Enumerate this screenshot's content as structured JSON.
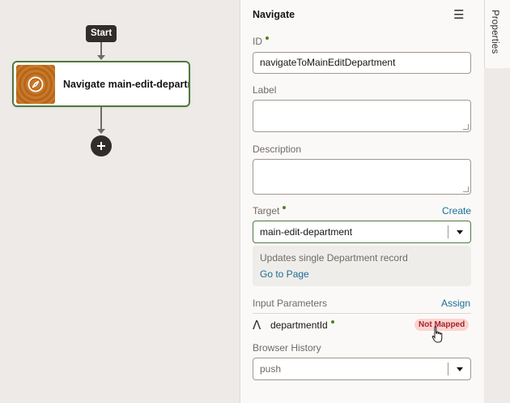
{
  "canvas": {
    "start_label": "Start",
    "node": {
      "title": "Navigate main-edit-department",
      "icon": "compass-icon",
      "border_color": "#4f7a3c"
    },
    "add_icon": "plus-circle-icon"
  },
  "panel": {
    "title": "Navigate",
    "menu_icon": "hamburger-icon",
    "id": {
      "label": "ID",
      "value": "navigateToMainEditDepartment"
    },
    "label_field": {
      "label": "Label",
      "value": ""
    },
    "description": {
      "label": "Description",
      "value": ""
    },
    "target": {
      "label": "Target",
      "create_link": "Create",
      "value": "main-edit-department",
      "info_text": "Updates single Department record",
      "goto_link": "Go to Page"
    },
    "input_parameters": {
      "label": "Input Parameters",
      "assign_link": "Assign",
      "items": [
        {
          "icon": "text-type-icon",
          "name": "departmentId",
          "status": "Not Mapped",
          "status_color": "#a3252b"
        }
      ]
    },
    "browser_history": {
      "label": "Browser History",
      "value": "push"
    }
  },
  "rail": {
    "tab_label": "Properties"
  }
}
